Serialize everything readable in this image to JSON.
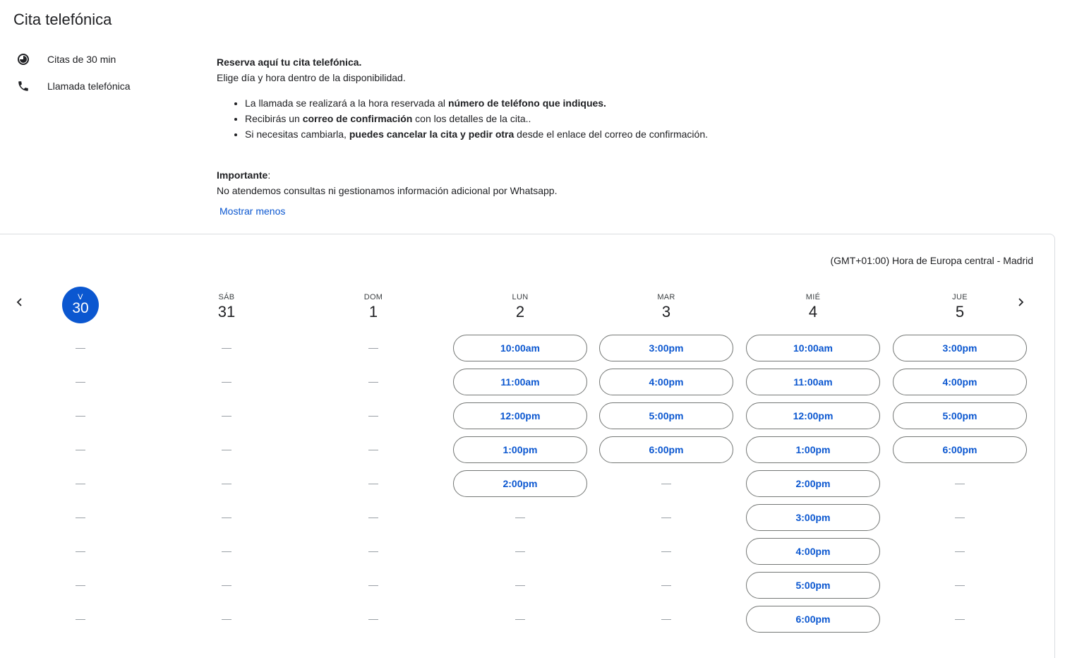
{
  "page": {
    "title": "Cita telefónica",
    "duration_label": "Citas de 30 min",
    "call_type_label": "Llamada telefónica"
  },
  "description": {
    "heading": "Reserva aquí tu cita telefónica.",
    "subheading": "Elige día y hora dentro de la disponibilidad.",
    "bullets": [
      {
        "pre": "La llamada se realizará a la hora reservada al ",
        "bold": "número de teléfono que indiques.",
        "post": ""
      },
      {
        "pre": "Recibirás un ",
        "bold": "correo de confirmación",
        "post": " con los detalles de la cita.."
      },
      {
        "pre": "Si necesitas cambiarla, ",
        "bold": "puedes cancelar la cita y pedir otra",
        "post": " desde el enlace del correo de confirmación."
      }
    ],
    "important_label": "Importante",
    "important_colon": ":",
    "important_text": "No atendemos consultas ni gestionamos información adicional por Whatsapp."
  },
  "show_less_link": "Mostrar menos",
  "timezone": "(GMT+01:00) Hora de Europa central - Madrid",
  "icons": {
    "duration": "clock-icon",
    "phone": "phone-icon",
    "prev": "chevron-left-icon",
    "next": "chevron-right-icon"
  },
  "colors": {
    "accent": "#0b57d0",
    "border": "#747775",
    "dash": "#9aa0a6"
  },
  "rows": 9,
  "days": [
    {
      "dow": "V",
      "num": "30",
      "today": true,
      "slots": []
    },
    {
      "dow": "SÁB",
      "num": "31",
      "slots": []
    },
    {
      "dow": "DOM",
      "num": "1",
      "slots": []
    },
    {
      "dow": "LUN",
      "num": "2",
      "slots": [
        "10:00am",
        "11:00am",
        "12:00pm",
        "1:00pm",
        "2:00pm"
      ]
    },
    {
      "dow": "MAR",
      "num": "3",
      "slots": [
        "3:00pm",
        "4:00pm",
        "5:00pm",
        "6:00pm"
      ]
    },
    {
      "dow": "MIÉ",
      "num": "4",
      "slots": [
        "10:00am",
        "11:00am",
        "12:00pm",
        "1:00pm",
        "2:00pm",
        "3:00pm",
        "4:00pm",
        "5:00pm",
        "6:00pm"
      ]
    },
    {
      "dow": "JUE",
      "num": "5",
      "slots": [
        "3:00pm",
        "4:00pm",
        "5:00pm",
        "6:00pm"
      ]
    }
  ]
}
